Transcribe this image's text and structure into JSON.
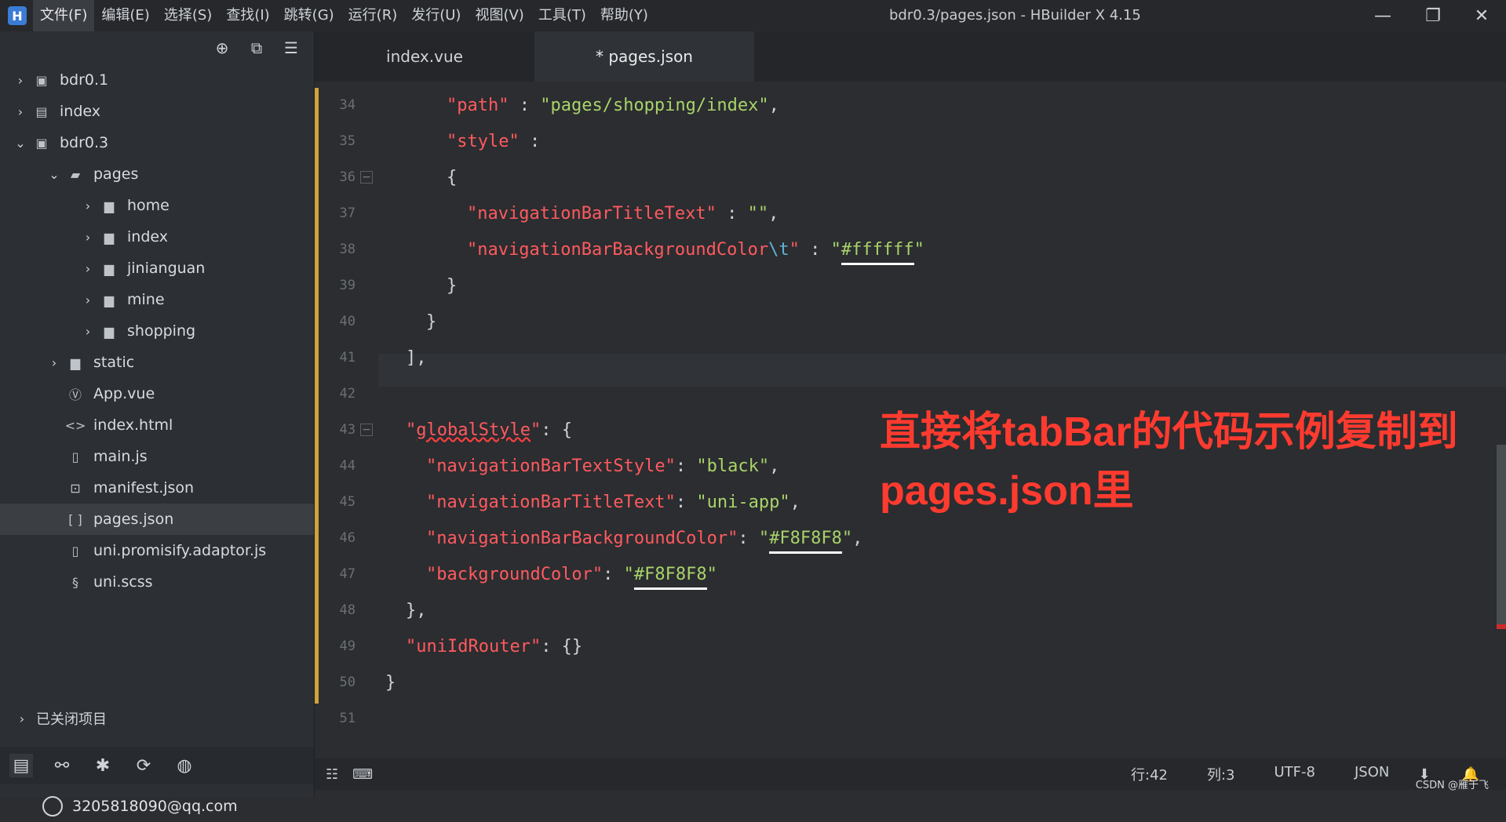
{
  "app": {
    "logo_letter": "H",
    "window_title": "bdr0.3/pages.json - HBuilder X 4.15",
    "window_controls": [
      "minimize",
      "restore",
      "close"
    ]
  },
  "menu": {
    "items": [
      "文件(F)",
      "编辑(E)",
      "选择(S)",
      "查找(I)",
      "跳转(G)",
      "运行(R)",
      "发行(U)",
      "视图(V)",
      "工具(T)",
      "帮助(Y)"
    ],
    "active_index": 0
  },
  "sidebar": {
    "toolbar_icons": [
      "crosshair-icon",
      "file-copy-icon",
      "menu-icon"
    ],
    "tree": [
      {
        "label": "bdr0.1",
        "level": 0,
        "expanded": false,
        "icon": "project-icon"
      },
      {
        "label": "index",
        "level": 0,
        "expanded": false,
        "icon": "folder-list-icon"
      },
      {
        "label": "bdr0.3",
        "level": 0,
        "expanded": true,
        "icon": "project-icon"
      },
      {
        "label": "pages",
        "level": 1,
        "expanded": true,
        "icon": "folder-open-icon"
      },
      {
        "label": "home",
        "level": 2,
        "expanded": false,
        "icon": "folder-icon"
      },
      {
        "label": "index",
        "level": 2,
        "expanded": false,
        "icon": "folder-icon"
      },
      {
        "label": "jinianguan",
        "level": 2,
        "expanded": false,
        "icon": "folder-icon"
      },
      {
        "label": "mine",
        "level": 2,
        "expanded": false,
        "icon": "folder-icon"
      },
      {
        "label": "shopping",
        "level": 2,
        "expanded": false,
        "icon": "folder-icon"
      },
      {
        "label": "static",
        "level": 1,
        "expanded": false,
        "icon": "folder-icon"
      },
      {
        "label": "App.vue",
        "level": 1,
        "icon": "vue-file-icon"
      },
      {
        "label": "index.html",
        "level": 1,
        "icon": "html-file-icon"
      },
      {
        "label": "main.js",
        "level": 1,
        "icon": "js-file-icon"
      },
      {
        "label": "manifest.json",
        "level": 1,
        "icon": "manifest-icon"
      },
      {
        "label": "pages.json",
        "level": 1,
        "icon": "json-file-icon",
        "selected": true
      },
      {
        "label": "uni.promisify.adaptor.js",
        "level": 1,
        "icon": "js-file-icon"
      },
      {
        "label": "uni.scss",
        "level": 1,
        "icon": "scss-file-icon"
      }
    ],
    "closed_projects_label": "已关闭项目",
    "bottom_icons": [
      "explorer-icon",
      "binoculars-icon",
      "bug-icon",
      "git-icon",
      "globe-icon"
    ],
    "account_email": "3205818090@qq.com"
  },
  "editor": {
    "tabs": [
      {
        "label": "index.vue",
        "active": false
      },
      {
        "label": "* pages.json",
        "active": true
      }
    ],
    "lines": [
      {
        "num": "34",
        "fold": false,
        "indent": 3,
        "tokens": [
          [
            "key",
            "\"path\""
          ],
          [
            "punc",
            " : "
          ],
          [
            "str",
            "\"pages/shopping/index\""
          ],
          [
            "punc",
            ","
          ]
        ]
      },
      {
        "num": "35",
        "fold": false,
        "indent": 3,
        "tokens": [
          [
            "key",
            "\"style\""
          ],
          [
            "punc",
            " :"
          ]
        ]
      },
      {
        "num": "36",
        "fold": true,
        "indent": 3,
        "tokens": [
          [
            "punc",
            "{"
          ]
        ]
      },
      {
        "num": "37",
        "fold": false,
        "indent": 4,
        "tokens": [
          [
            "key",
            "\"navigationBarTitleText\""
          ],
          [
            "punc",
            " : "
          ],
          [
            "str",
            "\"\""
          ],
          [
            "punc",
            ","
          ]
        ]
      },
      {
        "num": "38",
        "fold": false,
        "indent": 4,
        "tokens": [
          [
            "key",
            "\"navigationBarBackgroundColor"
          ],
          [
            "escape",
            "\\t"
          ],
          [
            "key",
            "\""
          ],
          [
            "punc",
            " : "
          ],
          [
            "str",
            "\""
          ],
          [
            "str-u",
            "#ffffff"
          ],
          [
            "str",
            "\""
          ]
        ]
      },
      {
        "num": "39",
        "fold": false,
        "indent": 3,
        "tokens": [
          [
            "punc",
            "}"
          ]
        ]
      },
      {
        "num": "40",
        "fold": false,
        "indent": 2,
        "tokens": [
          [
            "punc",
            "}"
          ]
        ]
      },
      {
        "num": "41",
        "fold": false,
        "indent": 1,
        "tokens": [
          [
            "punc",
            "],"
          ]
        ]
      },
      {
        "num": "42",
        "fold": false,
        "indent": 0,
        "tokens": []
      },
      {
        "num": "43",
        "fold": true,
        "indent": 1,
        "tokens": [
          [
            "key",
            "\""
          ],
          [
            "key-sq",
            "globalStyle"
          ],
          [
            "key",
            "\""
          ],
          [
            "punc",
            ": {"
          ]
        ]
      },
      {
        "num": "44",
        "fold": false,
        "indent": 2,
        "tokens": [
          [
            "key",
            "\"navigationBarTextStyle\""
          ],
          [
            "punc",
            ": "
          ],
          [
            "str",
            "\"black\""
          ],
          [
            "punc",
            ","
          ]
        ]
      },
      {
        "num": "45",
        "fold": false,
        "indent": 2,
        "tokens": [
          [
            "key",
            "\"navigationBarTitleText\""
          ],
          [
            "punc",
            ": "
          ],
          [
            "str",
            "\"uni-app\""
          ],
          [
            "punc",
            ","
          ]
        ]
      },
      {
        "num": "46",
        "fold": false,
        "indent": 2,
        "tokens": [
          [
            "key",
            "\"navigationBarBackgroundColor\""
          ],
          [
            "punc",
            ": "
          ],
          [
            "str",
            "\""
          ],
          [
            "str-u",
            "#F8F8F8"
          ],
          [
            "str",
            "\""
          ],
          [
            "punc",
            ","
          ]
        ]
      },
      {
        "num": "47",
        "fold": false,
        "indent": 2,
        "tokens": [
          [
            "key",
            "\"backgroundColor\""
          ],
          [
            "punc",
            ": "
          ],
          [
            "str",
            "\""
          ],
          [
            "str-u",
            "#F8F8F8"
          ],
          [
            "str",
            "\""
          ]
        ]
      },
      {
        "num": "48",
        "fold": false,
        "indent": 1,
        "tokens": [
          [
            "punc",
            "},"
          ]
        ]
      },
      {
        "num": "49",
        "fold": false,
        "indent": 1,
        "tokens": [
          [
            "key",
            "\"uniIdRouter\""
          ],
          [
            "punc",
            ": {}"
          ]
        ]
      },
      {
        "num": "50",
        "fold": false,
        "indent": 0,
        "tokens": [
          [
            "punc",
            "}"
          ]
        ]
      },
      {
        "num": "51",
        "fold": false,
        "indent": 0,
        "tokens": []
      }
    ],
    "annotation": "直接将tabBar的代码示例复制到pages.json里"
  },
  "status": {
    "left_icons": [
      "list-icon",
      "terminal-icon"
    ],
    "line": "行:42",
    "col": "列:3",
    "encoding": "UTF-8",
    "language": "JSON",
    "right_icons": [
      "download-icon",
      "bell-icon"
    ],
    "watermark": "CSDN @雁于飞"
  },
  "colors": {
    "accent_gutter": "#d1a23a",
    "annotation": "#ff3b2f",
    "json_key": "#ff5a5f",
    "json_string": "#a9d36a"
  }
}
